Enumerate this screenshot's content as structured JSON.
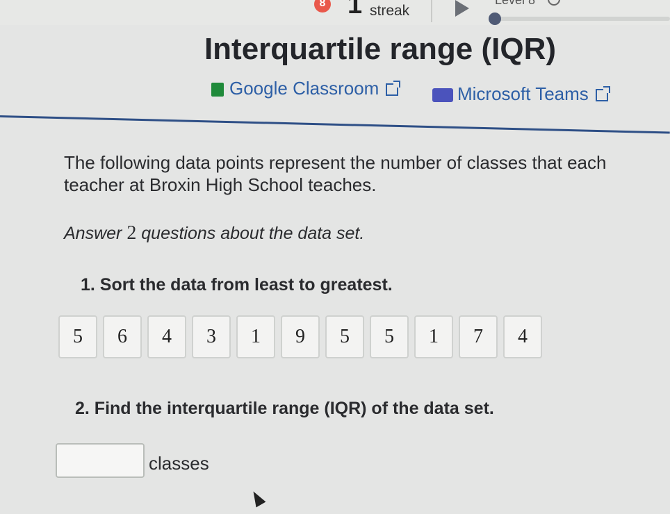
{
  "header": {
    "streak_badge": "8",
    "streak_count": "1",
    "streak_label": "streak",
    "level_label": "Level 8"
  },
  "page": {
    "title": "Interquartile range (IQR)",
    "share": {
      "google_classroom": "Google Classroom",
      "microsoft_teams": "Microsoft Teams"
    }
  },
  "problem": {
    "intro": "The following data points represent the number of classes that each teacher at Broxin High School teaches.",
    "answer_prefix": "Answer ",
    "answer_count": "2",
    "answer_suffix": " questions about the data set.",
    "q1": "1. Sort the data from least to greatest.",
    "tiles": [
      "5",
      "6",
      "4",
      "3",
      "1",
      "9",
      "5",
      "5",
      "1",
      "7",
      "4"
    ],
    "q2": "2. Find the interquartile range (IQR) of the data set.",
    "answer_value": "",
    "units": "classes"
  },
  "colors": {
    "link": "#2d5fa6",
    "rule": "#2e4f86",
    "badge": "#e9584b"
  }
}
